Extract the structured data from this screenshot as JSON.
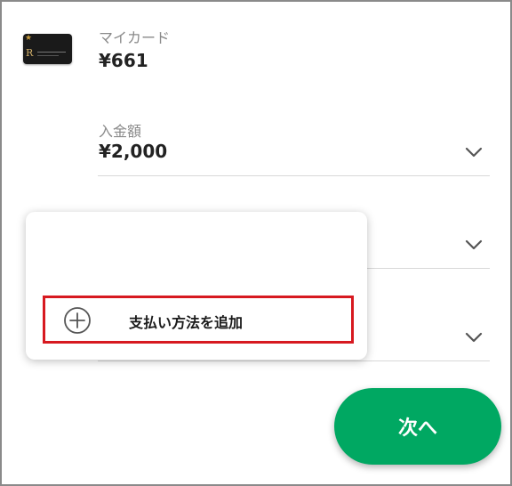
{
  "card": {
    "label": "マイカード",
    "balance": "¥661"
  },
  "deposit": {
    "label": "入金額",
    "amount": "¥2,000"
  },
  "popup": {
    "add_payment_label": "支払い方法を追加"
  },
  "next_button": {
    "label": "次へ"
  },
  "icons": [
    "card-image",
    "chevron-down-icon",
    "plus-circle-icon"
  ],
  "colors": {
    "accent_green": "#00a862",
    "highlight_red": "#d71920"
  }
}
